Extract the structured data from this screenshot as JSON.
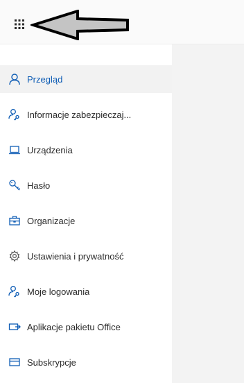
{
  "colors": {
    "accent": "#0f5db5",
    "text": "#2b2b2b",
    "active_bg": "#f2f2f2"
  },
  "header": {
    "waffle_icon": "app-launcher-icon",
    "annotation_icon": "left-arrow-icon"
  },
  "sidebar": {
    "items": [
      {
        "label": "Przegląd",
        "icon": "person-icon",
        "active": true
      },
      {
        "label": "Informacje zabezpieczaj...",
        "icon": "person-key-icon",
        "active": false
      },
      {
        "label": "Urządzenia",
        "icon": "laptop-icon",
        "active": false
      },
      {
        "label": "Hasło",
        "icon": "key-icon",
        "active": false
      },
      {
        "label": "Organizacje",
        "icon": "briefcase-icon",
        "active": false
      },
      {
        "label": "Ustawienia i prywatność",
        "icon": "gear-icon",
        "active": false
      },
      {
        "label": "Moje logowania",
        "icon": "person-key-icon",
        "active": false
      },
      {
        "label": "Aplikacje pakietu Office",
        "icon": "office-apps-icon",
        "active": false
      },
      {
        "label": "Subskrypcje",
        "icon": "card-icon",
        "active": false
      }
    ]
  }
}
